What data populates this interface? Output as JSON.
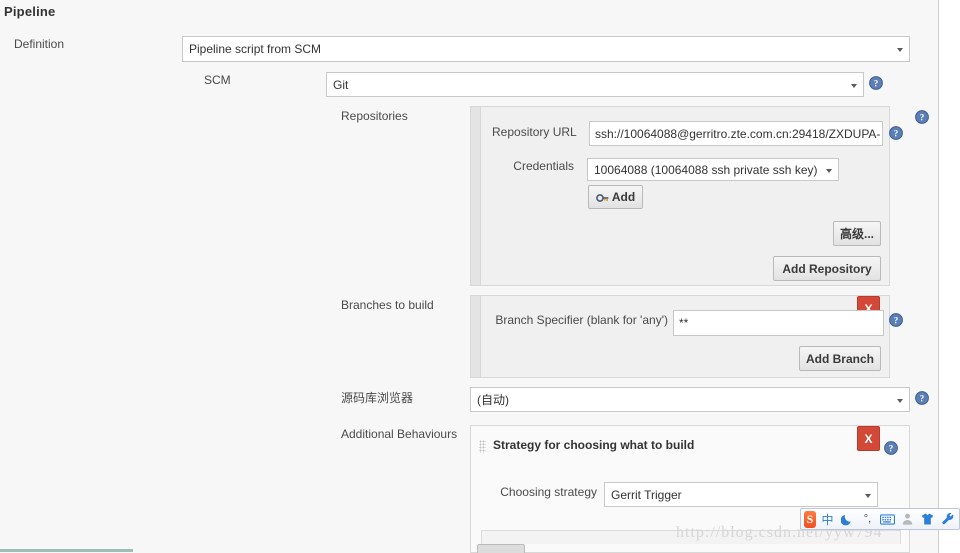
{
  "section": {
    "title": "Pipeline"
  },
  "definition": {
    "label": "Definition",
    "value": "Pipeline script from SCM"
  },
  "scm": {
    "label": "SCM",
    "value": "Git",
    "help_icon": "help-icon"
  },
  "repositories": {
    "label": "Repositories",
    "url_label": "Repository URL",
    "url_value": "ssh://10064088@gerritro.zte.com.cn:29418/ZXDUPA-",
    "credentials_label": "Credentials",
    "credentials_value": "10064088 (10064088 ssh private ssh key)",
    "add_credentials_label": "Add",
    "advanced_label": "高级...",
    "add_repository_label": "Add Repository"
  },
  "branches": {
    "label": "Branches to build",
    "specifier_label": "Branch Specifier (blank for 'any')",
    "specifier_value": "**",
    "add_branch_label": "Add Branch",
    "delete_label": "X"
  },
  "browser": {
    "label": "源码库浏览器",
    "value": "(自动)"
  },
  "additional_behaviours": {
    "label": "Additional Behaviours",
    "strategy_title": "Strategy for choosing what to build",
    "choosing_strategy_label": "Choosing strategy",
    "choosing_strategy_value": "Gerrit Trigger",
    "delete_label": "X"
  },
  "watermark": {
    "text": "http://blog.csdn.net/yyw794"
  },
  "ime": {
    "logo": "sogou-logo-icon",
    "items": [
      {
        "name": "chinese-mode-icon",
        "glyph": "中"
      },
      {
        "name": "moon-icon",
        "glyph": ""
      },
      {
        "name": "degree-comma-icon",
        "glyph": "°,"
      },
      {
        "name": "keyboard-icon",
        "glyph": ""
      },
      {
        "name": "user-icon",
        "glyph": ""
      },
      {
        "name": "skin-shirt-icon",
        "glyph": ""
      },
      {
        "name": "toolbox-wrench-icon",
        "glyph": ""
      }
    ]
  },
  "colors": {
    "page_bg": "#f7f7f7",
    "panel_bg": "#f0f0f0",
    "danger": "#d34836",
    "help_blue": "#4a6fa5",
    "border": "#c8c8c8"
  }
}
